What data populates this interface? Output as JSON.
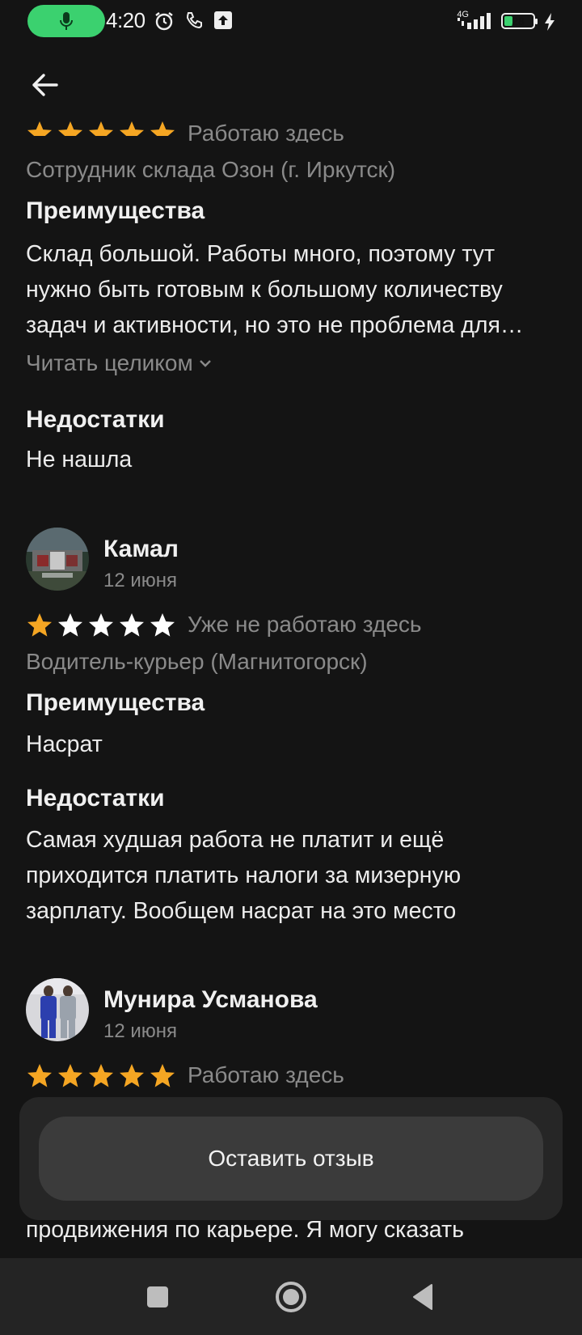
{
  "status_bar": {
    "time": "4:20",
    "network": "4G",
    "battery_percent": "28",
    "battery_level": 0.28,
    "icons": [
      "microphone-icon",
      "alarm-icon",
      "phone-icon",
      "upload-icon",
      "signal-icon",
      "battery-icon",
      "charging-icon"
    ]
  },
  "header": {
    "back_icon": "arrow-left-icon"
  },
  "colors": {
    "background": "#141414",
    "star_filled": "#f5a623",
    "star_empty": "#ffffff",
    "muted_text": "#8a8a8a",
    "accent_green": "#3bd16f"
  },
  "reviews": [
    {
      "rating": 5,
      "employment_status": "Работаю здесь",
      "position": "Сотрудник склада Озон (г. Иркутск)",
      "pros_title": "Преимущества",
      "pros_lines": [
        "Склад большой. Работы много, поэтому тут",
        "нужно быть готовым к большому количеству",
        "задач и активности, но это не проблема для…"
      ],
      "read_more": "Читать целиком",
      "cons_title": "Недостатки",
      "cons_lines": [
        "Не нашла"
      ]
    },
    {
      "author": "Камал",
      "date": "12 июня",
      "rating": 1,
      "employment_status": "Уже не работаю здесь",
      "position": "Водитель-курьер (Магнитогорск)",
      "pros_title": "Преимущества",
      "pros_lines": [
        "Насрат"
      ],
      "cons_title": "Недостатки",
      "cons_lines": [
        "Самая худшая работа не платит и ещё",
        "приходится платить налоги за мизерную",
        "зарплату. Вообщем насрат на это место"
      ]
    },
    {
      "author": "Мунира Усманова",
      "date": "12 июня",
      "rating": 5,
      "employment_status": "Работаю здесь",
      "partial_text": "продвижения по карьере. Я могу сказать"
    }
  ],
  "cta": {
    "label": "Оставить отзыв"
  },
  "nav": {
    "icons": [
      "recents-square-icon",
      "home-circle-icon",
      "back-triangle-icon"
    ]
  }
}
